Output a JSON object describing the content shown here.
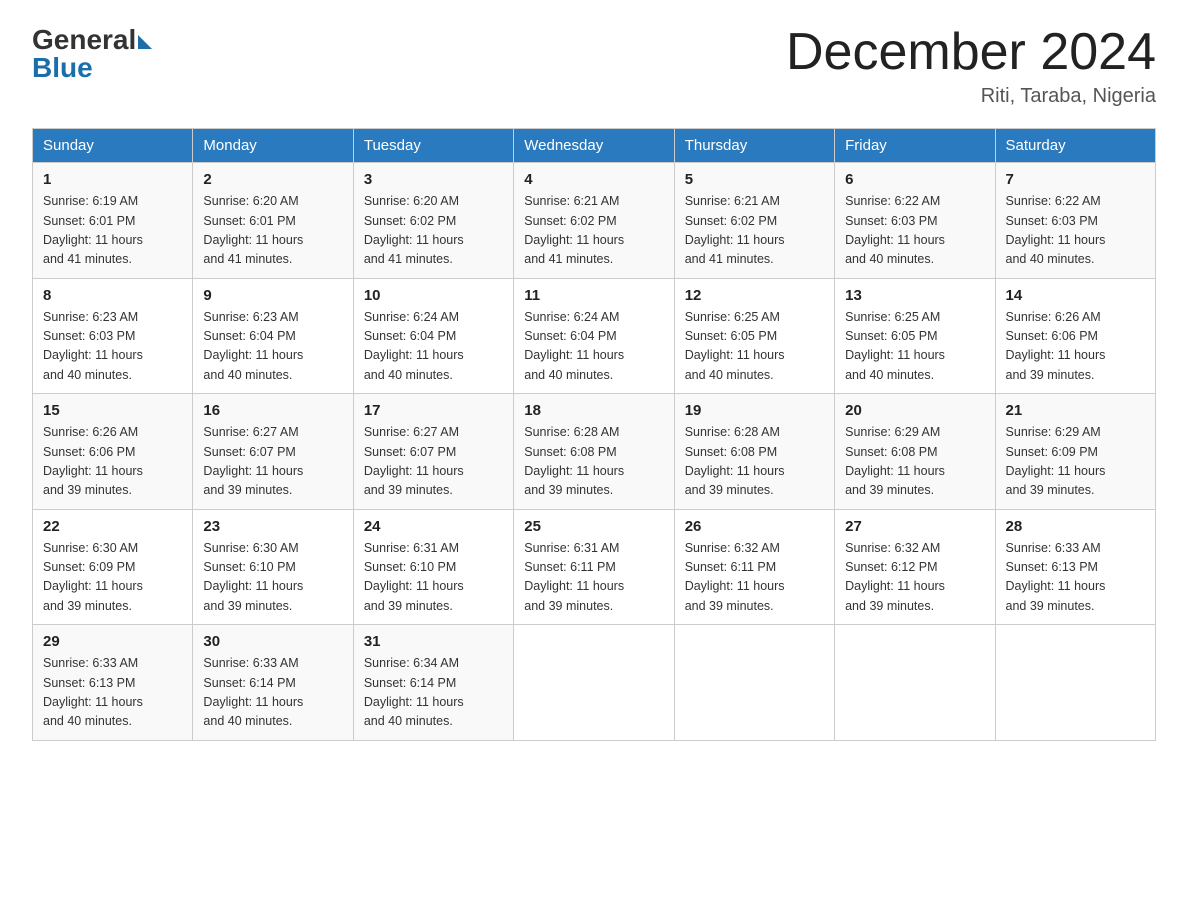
{
  "header": {
    "logo_general": "General",
    "logo_blue": "Blue",
    "month_title": "December 2024",
    "location": "Riti, Taraba, Nigeria"
  },
  "days_of_week": [
    "Sunday",
    "Monday",
    "Tuesday",
    "Wednesday",
    "Thursday",
    "Friday",
    "Saturday"
  ],
  "weeks": [
    [
      {
        "day": "1",
        "sunrise": "6:19 AM",
        "sunset": "6:01 PM",
        "daylight": "11 hours and 41 minutes."
      },
      {
        "day": "2",
        "sunrise": "6:20 AM",
        "sunset": "6:01 PM",
        "daylight": "11 hours and 41 minutes."
      },
      {
        "day": "3",
        "sunrise": "6:20 AM",
        "sunset": "6:02 PM",
        "daylight": "11 hours and 41 minutes."
      },
      {
        "day": "4",
        "sunrise": "6:21 AM",
        "sunset": "6:02 PM",
        "daylight": "11 hours and 41 minutes."
      },
      {
        "day": "5",
        "sunrise": "6:21 AM",
        "sunset": "6:02 PM",
        "daylight": "11 hours and 41 minutes."
      },
      {
        "day": "6",
        "sunrise": "6:22 AM",
        "sunset": "6:03 PM",
        "daylight": "11 hours and 40 minutes."
      },
      {
        "day": "7",
        "sunrise": "6:22 AM",
        "sunset": "6:03 PM",
        "daylight": "11 hours and 40 minutes."
      }
    ],
    [
      {
        "day": "8",
        "sunrise": "6:23 AM",
        "sunset": "6:03 PM",
        "daylight": "11 hours and 40 minutes."
      },
      {
        "day": "9",
        "sunrise": "6:23 AM",
        "sunset": "6:04 PM",
        "daylight": "11 hours and 40 minutes."
      },
      {
        "day": "10",
        "sunrise": "6:24 AM",
        "sunset": "6:04 PM",
        "daylight": "11 hours and 40 minutes."
      },
      {
        "day": "11",
        "sunrise": "6:24 AM",
        "sunset": "6:04 PM",
        "daylight": "11 hours and 40 minutes."
      },
      {
        "day": "12",
        "sunrise": "6:25 AM",
        "sunset": "6:05 PM",
        "daylight": "11 hours and 40 minutes."
      },
      {
        "day": "13",
        "sunrise": "6:25 AM",
        "sunset": "6:05 PM",
        "daylight": "11 hours and 40 minutes."
      },
      {
        "day": "14",
        "sunrise": "6:26 AM",
        "sunset": "6:06 PM",
        "daylight": "11 hours and 39 minutes."
      }
    ],
    [
      {
        "day": "15",
        "sunrise": "6:26 AM",
        "sunset": "6:06 PM",
        "daylight": "11 hours and 39 minutes."
      },
      {
        "day": "16",
        "sunrise": "6:27 AM",
        "sunset": "6:07 PM",
        "daylight": "11 hours and 39 minutes."
      },
      {
        "day": "17",
        "sunrise": "6:27 AM",
        "sunset": "6:07 PM",
        "daylight": "11 hours and 39 minutes."
      },
      {
        "day": "18",
        "sunrise": "6:28 AM",
        "sunset": "6:08 PM",
        "daylight": "11 hours and 39 minutes."
      },
      {
        "day": "19",
        "sunrise": "6:28 AM",
        "sunset": "6:08 PM",
        "daylight": "11 hours and 39 minutes."
      },
      {
        "day": "20",
        "sunrise": "6:29 AM",
        "sunset": "6:08 PM",
        "daylight": "11 hours and 39 minutes."
      },
      {
        "day": "21",
        "sunrise": "6:29 AM",
        "sunset": "6:09 PM",
        "daylight": "11 hours and 39 minutes."
      }
    ],
    [
      {
        "day": "22",
        "sunrise": "6:30 AM",
        "sunset": "6:09 PM",
        "daylight": "11 hours and 39 minutes."
      },
      {
        "day": "23",
        "sunrise": "6:30 AM",
        "sunset": "6:10 PM",
        "daylight": "11 hours and 39 minutes."
      },
      {
        "day": "24",
        "sunrise": "6:31 AM",
        "sunset": "6:10 PM",
        "daylight": "11 hours and 39 minutes."
      },
      {
        "day": "25",
        "sunrise": "6:31 AM",
        "sunset": "6:11 PM",
        "daylight": "11 hours and 39 minutes."
      },
      {
        "day": "26",
        "sunrise": "6:32 AM",
        "sunset": "6:11 PM",
        "daylight": "11 hours and 39 minutes."
      },
      {
        "day": "27",
        "sunrise": "6:32 AM",
        "sunset": "6:12 PM",
        "daylight": "11 hours and 39 minutes."
      },
      {
        "day": "28",
        "sunrise": "6:33 AM",
        "sunset": "6:13 PM",
        "daylight": "11 hours and 39 minutes."
      }
    ],
    [
      {
        "day": "29",
        "sunrise": "6:33 AM",
        "sunset": "6:13 PM",
        "daylight": "11 hours and 40 minutes."
      },
      {
        "day": "30",
        "sunrise": "6:33 AM",
        "sunset": "6:14 PM",
        "daylight": "11 hours and 40 minutes."
      },
      {
        "day": "31",
        "sunrise": "6:34 AM",
        "sunset": "6:14 PM",
        "daylight": "11 hours and 40 minutes."
      },
      null,
      null,
      null,
      null
    ]
  ]
}
